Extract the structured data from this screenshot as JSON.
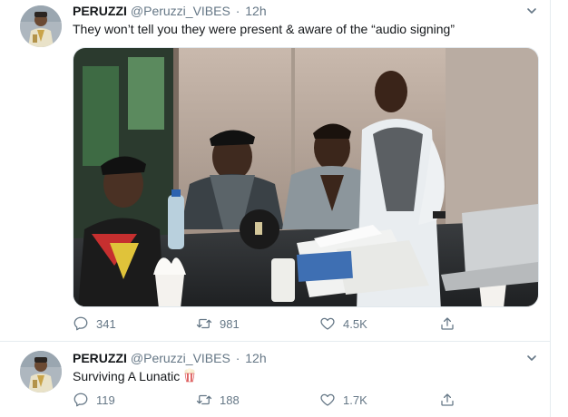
{
  "colors": {
    "text_primary": "#14171a",
    "text_secondary": "#657786",
    "border": "#e6ecf0",
    "background": "#ffffff"
  },
  "tweets": [
    {
      "display_name": "PERUZZI",
      "handle": "@Peruzzi_VIBES",
      "separator": "·",
      "time": "12h",
      "text": "They won’t tell you they were present & aware of the “audio signing”",
      "media": {
        "type": "photo",
        "alt": "",
        "icon": "photo"
      },
      "actions": {
        "replies": "341",
        "retweets": "981",
        "likes": "4.5K",
        "share_icon": "share-icon"
      }
    },
    {
      "display_name": "PERUZZI",
      "handle": "@Peruzzi_VIBES",
      "separator": "·",
      "time": "12h",
      "text": "Surviving A Lunatic",
      "emoji": "popcorn",
      "actions": {
        "replies": "119",
        "retweets": "188",
        "likes": "1.7K",
        "share_icon": "share-icon"
      }
    }
  ]
}
